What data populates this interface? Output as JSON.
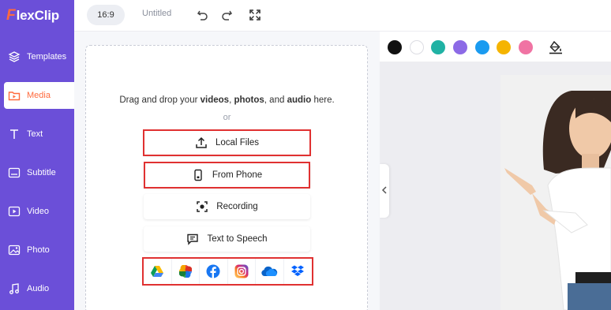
{
  "brand": {
    "logo_mark": "F",
    "logo_text": "lexClip",
    "orange": "#ff6a3d",
    "purple": "#6b4fd8"
  },
  "sidebar": {
    "items": [
      {
        "label": "Templates",
        "icon": "layers-icon"
      },
      {
        "label": "Media",
        "icon": "media-folder-icon",
        "active": true
      },
      {
        "label": "Text",
        "icon": "text-icon"
      },
      {
        "label": "Subtitle",
        "icon": "subtitle-icon"
      },
      {
        "label": "Video",
        "icon": "video-icon"
      },
      {
        "label": "Photo",
        "icon": "photo-icon"
      },
      {
        "label": "Audio",
        "icon": "music-note-icon"
      }
    ]
  },
  "topbar": {
    "ratio": "16:9",
    "title": "Untitled",
    "icons": [
      "undo-icon",
      "redo-icon",
      "fullscreen-icon"
    ]
  },
  "media_panel": {
    "drop_prefix": "Drag and drop your",
    "drop_videos": "videos",
    "drop_sep1": ",",
    "drop_photos": "photos",
    "drop_sep2": ", and",
    "drop_audio": "audio",
    "drop_suffix": "here.",
    "or": "or",
    "buttons": [
      {
        "label": "Local Files",
        "icon": "upload-icon"
      },
      {
        "label": "From Phone",
        "icon": "phone-icon"
      },
      {
        "label": "Recording",
        "icon": "record-icon"
      },
      {
        "label": "Text to Speech",
        "icon": "speech-icon"
      }
    ],
    "services": [
      "google-drive-icon",
      "google-photos-icon",
      "facebook-icon",
      "instagram-icon",
      "onedrive-icon",
      "dropbox-icon"
    ]
  },
  "colors": [
    "#111111",
    "#ffffff",
    "#20b2a4",
    "#8c6ae6",
    "#1a9bf0",
    "#f5b400",
    "#f073a3"
  ],
  "canvas": {
    "fill_tool_icon": "paint-bucket-icon",
    "collapse_icon": "chevron-left-icon"
  }
}
